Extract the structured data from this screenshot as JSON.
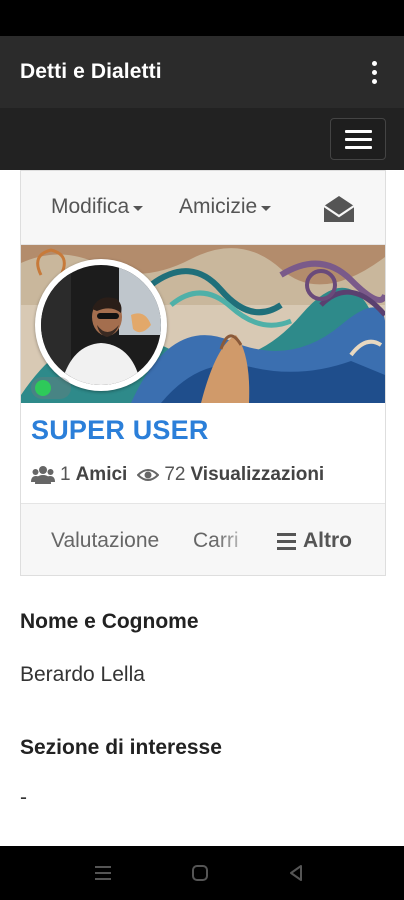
{
  "app": {
    "title": "Detti e Dialetti"
  },
  "toolbar": {
    "edit_label": "Modifica",
    "friendship_label": "Amicizie"
  },
  "profile": {
    "name": "SUPER USER",
    "friends_count": "1",
    "friends_label": "Amici",
    "views_count": "72",
    "views_label": "Visualizzazioni",
    "status": "online"
  },
  "tabs": {
    "rating": "Valutazione",
    "partial": "Carri",
    "more": "Altro"
  },
  "info": {
    "fullname_label": "Nome e Cognome",
    "fullname_value": "Berardo Lella",
    "interest_label": "Sezione di interesse",
    "interest_value": "-"
  },
  "colors": {
    "app_bar": "#2b2b2b",
    "nav_bar": "#222222",
    "accent": "#2b7fd9",
    "online": "#2ec95a"
  },
  "icons": {
    "menu": "kebab-menu-icon",
    "nav": "hamburger-icon",
    "messages": "envelope-open-icon",
    "friends": "users-icon",
    "views": "eye-icon",
    "more": "bars-icon"
  }
}
